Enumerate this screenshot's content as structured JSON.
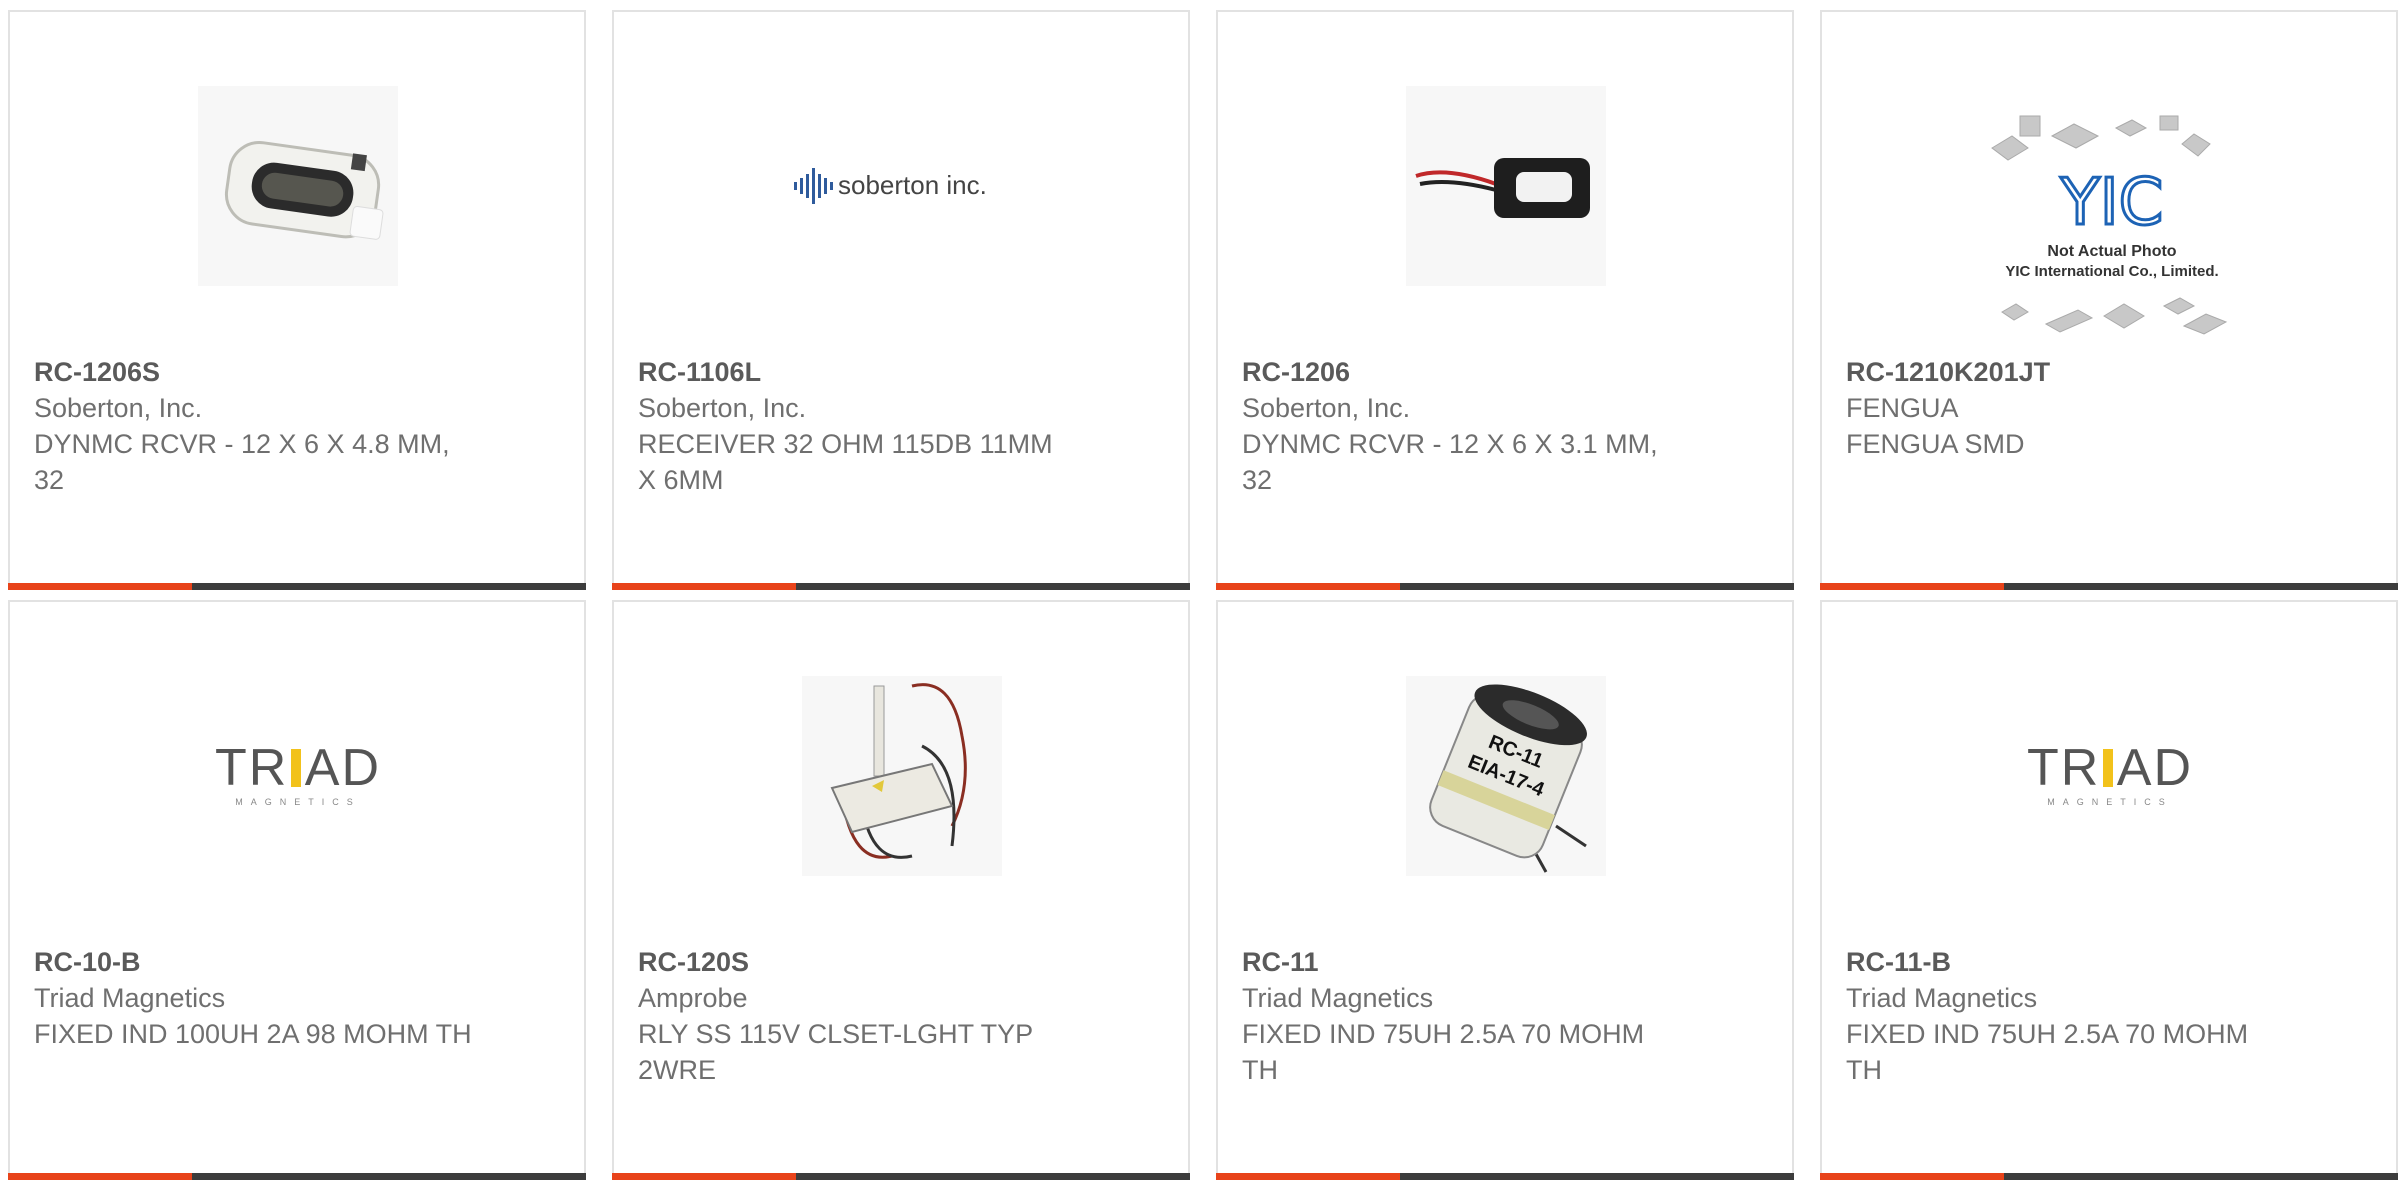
{
  "products": [
    {
      "part_number": "RC-1206S",
      "manufacturer": "Soberton, Inc.",
      "description": "DYNMC RCVR - 12 X 6 X 4.8 MM, 32",
      "image": "speaker-receiver-photo"
    },
    {
      "part_number": "RC-1106L",
      "manufacturer": "Soberton, Inc.",
      "description": "RECEIVER 32 OHM 115DB 11MM X 6MM",
      "image": "soberton-logo",
      "logo_text": "soberton inc."
    },
    {
      "part_number": "RC-1206",
      "manufacturer": "Soberton, Inc.",
      "description": "DYNMC RCVR - 12 X 6 X 3.1 MM, 32",
      "image": "wired-receiver-photo"
    },
    {
      "part_number": "RC-1210K201JT",
      "manufacturer": "FENGUA",
      "description": "FENGUA SMD",
      "image": "yic-placeholder",
      "logo_text": "YIC",
      "caption_1": "Not Actual Photo",
      "caption_2": "YIC International Co., Limited."
    },
    {
      "part_number": "RC-10-B",
      "manufacturer": "Triad Magnetics",
      "description": "FIXED IND 100UH 2A 98 MOHM TH",
      "image": "triad-logo",
      "logo_text": "TRIAD",
      "logo_sub": "MAGNETICS"
    },
    {
      "part_number": "RC-120S",
      "manufacturer": "Amprobe",
      "description": "RLY SS 115V CLSET-LGHT TYP 2WRE",
      "image": "relay-photo"
    },
    {
      "part_number": "RC-11",
      "manufacturer": "Triad Magnetics",
      "description": "FIXED IND 75UH 2.5A 70 MOHM TH",
      "image": "inductor-photo",
      "label_1": "RC-11",
      "label_2": "EIA-17-4"
    },
    {
      "part_number": "RC-11-B",
      "manufacturer": "Triad Magnetics",
      "description": "FIXED IND 75UH 2.5A 70 MOHM TH",
      "image": "triad-logo",
      "logo_text": "TRIAD",
      "logo_sub": "MAGNETICS"
    }
  ],
  "colors": {
    "accent": "#e8431a",
    "bar": "#3c3c3c",
    "border": "#e2e2e2",
    "text": "#6f6f6f"
  }
}
